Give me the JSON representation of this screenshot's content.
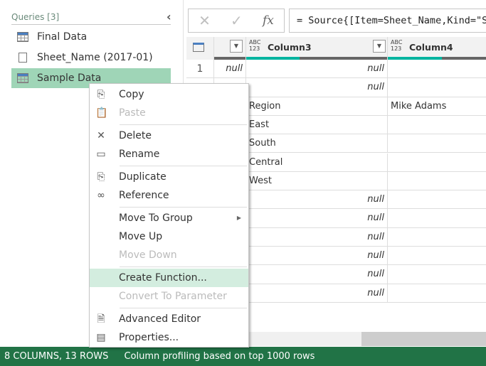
{
  "queries_pane": {
    "title": "Queries [3]",
    "items": [
      {
        "label": "Final Data",
        "icon": "table-icon"
      },
      {
        "label": "Sheet_Name (2017-01)",
        "icon": "parameter-icon"
      },
      {
        "label": "Sample Data",
        "icon": "table-icon",
        "selected": true
      }
    ]
  },
  "formula": {
    "cancel": "✕",
    "commit": "✓",
    "fx": "fx",
    "text": "= Source{[Item=Sheet_Name,Kind=\"S"
  },
  "grid": {
    "columns": [
      {
        "name": "",
        "type": ""
      },
      {
        "name": "Column3",
        "type": "ABC 123"
      },
      {
        "name": "Column4",
        "type": "ABC 123"
      }
    ],
    "rows": [
      [
        "1",
        "null",
        "null",
        ""
      ],
      [
        "",
        "",
        "null",
        ""
      ],
      [
        "",
        "",
        "Region",
        "Mike Adams"
      ],
      [
        "",
        "",
        "East",
        ""
      ],
      [
        "",
        "",
        "South",
        ""
      ],
      [
        "",
        "",
        "Central",
        ""
      ],
      [
        "",
        "",
        "West",
        ""
      ],
      [
        "",
        "",
        "null",
        ""
      ],
      [
        "",
        "",
        "null",
        ""
      ],
      [
        "",
        "",
        "null",
        ""
      ],
      [
        "",
        "",
        "null",
        ""
      ],
      [
        "",
        "",
        "null",
        ""
      ],
      [
        "",
        "",
        "null",
        ""
      ]
    ]
  },
  "context_menu": {
    "items": [
      {
        "label": "Copy",
        "icon": "copy-icon"
      },
      {
        "label": "Paste",
        "icon": "paste-icon",
        "disabled": true
      },
      {
        "label": "Delete",
        "icon": "delete-icon"
      },
      {
        "label": "Rename",
        "icon": "rename-icon"
      },
      {
        "label": "Duplicate",
        "icon": "duplicate-icon"
      },
      {
        "label": "Reference",
        "icon": "reference-icon"
      },
      {
        "label": "Move To Group",
        "submenu": true
      },
      {
        "label": "Move Up"
      },
      {
        "label": "Move Down",
        "disabled": true
      },
      {
        "label": "Create Function...",
        "highlighted": true
      },
      {
        "label": "Convert To Parameter",
        "disabled": true
      },
      {
        "label": "Advanced Editor",
        "icon": "advanced-editor-icon"
      },
      {
        "label": "Properties...",
        "icon": "properties-icon"
      }
    ]
  },
  "status": {
    "counts": "8 COLUMNS, 13 ROWS",
    "profiling": "Column profiling based on top 1000 rows"
  },
  "colors": {
    "accent": "#217346",
    "selection": "#9fd5b7",
    "profile": "#00b4a0"
  }
}
